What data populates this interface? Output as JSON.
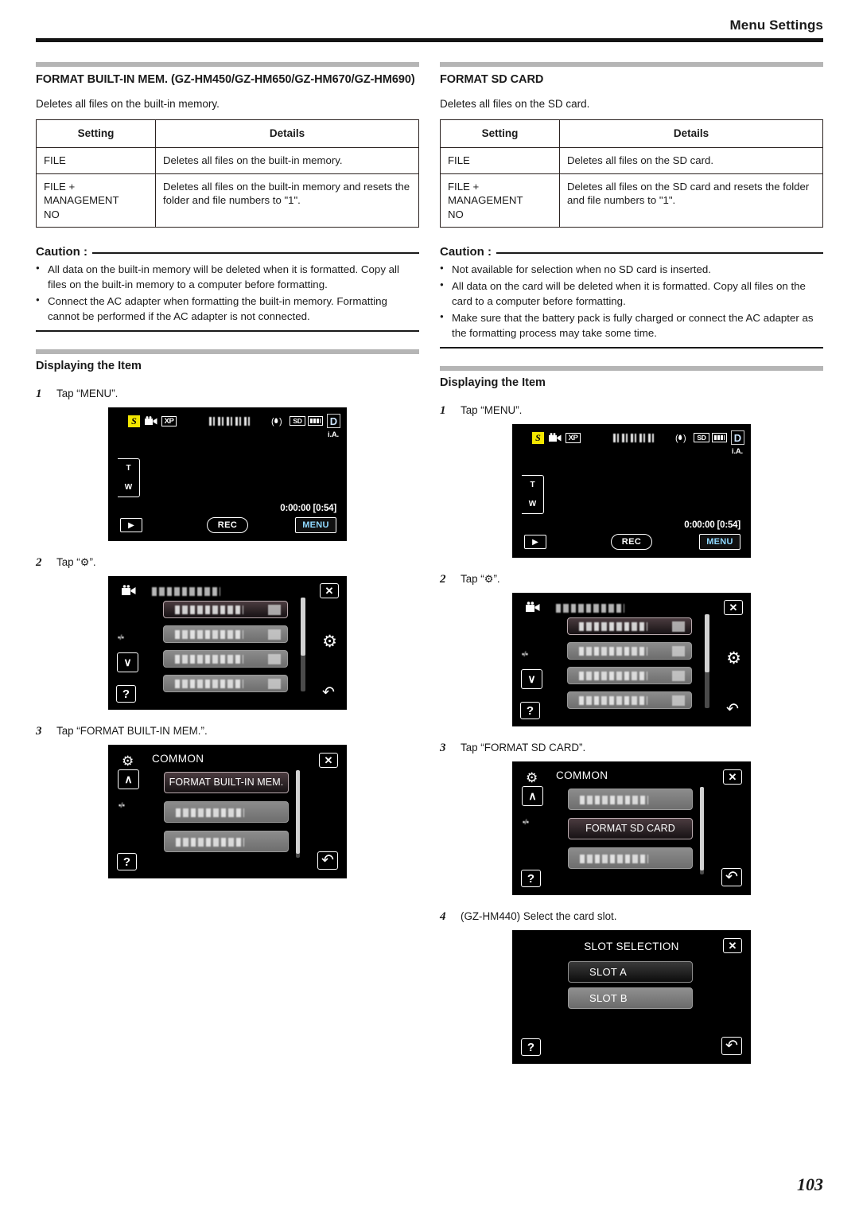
{
  "header": {
    "title": "Menu Settings"
  },
  "page_number": "103",
  "left": {
    "section_title": "FORMAT BUILT-IN MEM. (GZ-HM450/GZ-HM650/GZ-HM670/GZ-HM690)",
    "description": "Deletes all files on the built-in memory.",
    "table": {
      "headers": [
        "Setting",
        "Details"
      ],
      "rows": [
        {
          "setting": "FILE",
          "details": "Deletes all files on the built-in memory."
        },
        {
          "setting": "FILE +\nMANAGEMENT\nNO",
          "details": "Deletes all files on the built-in memory and resets the folder and file numbers to \"1\"."
        }
      ]
    },
    "caution": {
      "label": "Caution :",
      "items": [
        "All data on the built-in memory will be deleted when it is formatted. Copy all files on the built-in memory to a computer before formatting.",
        "Connect the AC adapter when formatting the built-in memory. Formatting cannot be performed if the AC adapter is not connected."
      ]
    },
    "displaying": {
      "title": "Displaying the Item",
      "steps": [
        {
          "num": "1",
          "text": "Tap “MENU”."
        },
        {
          "num": "2",
          "text_before": "Tap “",
          "glyph": "⚙",
          "text_after": "”."
        },
        {
          "num": "3",
          "text": "Tap “FORMAT BUILT-IN MEM.”."
        }
      ]
    },
    "screen3": {
      "title": "COMMON",
      "selected_item": "FORMAT BUILT-IN MEM.",
      "selected_index": 0
    }
  },
  "right": {
    "section_title": "FORMAT SD CARD",
    "description": "Deletes all files on the SD card.",
    "table": {
      "headers": [
        "Setting",
        "Details"
      ],
      "rows": [
        {
          "setting": "FILE",
          "details": "Deletes all files on the SD card."
        },
        {
          "setting": "FILE +\nMANAGEMENT\nNO",
          "details": "Deletes all files on the SD card and resets the folder and file numbers to \"1\"."
        }
      ]
    },
    "caution": {
      "label": "Caution :",
      "items": [
        "Not available for selection when no SD card is inserted.",
        "All data on the card will be deleted when it is formatted. Copy all files on the card to a computer before formatting.",
        "Make sure that the battery pack is fully charged or connect the AC adapter as the formatting process may take some time."
      ]
    },
    "displaying": {
      "title": "Displaying the Item",
      "steps": [
        {
          "num": "1",
          "text": "Tap “MENU”."
        },
        {
          "num": "2",
          "text_before": "Tap “",
          "glyph": "⚙",
          "text_after": "”."
        },
        {
          "num": "3",
          "text": "Tap “FORMAT SD CARD”."
        },
        {
          "num": "4",
          "text": "(GZ-HM440) Select the card slot."
        }
      ]
    },
    "screen3": {
      "title": "COMMON",
      "selected_item": "FORMAT SD CARD",
      "selected_index": 1
    },
    "slot_screen": {
      "title": "SLOT SELECTION",
      "slot_a": "SLOT A",
      "slot_b": "SLOT B"
    }
  },
  "rec_screen": {
    "mode_badge": "S",
    "quality_badge": "XP",
    "sd_badge": "SD",
    "digital_badge": "D",
    "ia_label": "i.A.",
    "zoom_tele": "T",
    "zoom_wide": "W",
    "timecode": "0:00:00  [0:54]",
    "rec_label": "REC",
    "menu_label": "MENU",
    "play_glyph": "▶"
  },
  "menu_screen": {
    "close_glyph": "✕",
    "gear_glyph": "⚙",
    "back_glyph": "↶",
    "help_glyph": "?",
    "down_glyph": "∨",
    "up_glyph": "∧",
    "page_indicator": "▪/▪"
  }
}
